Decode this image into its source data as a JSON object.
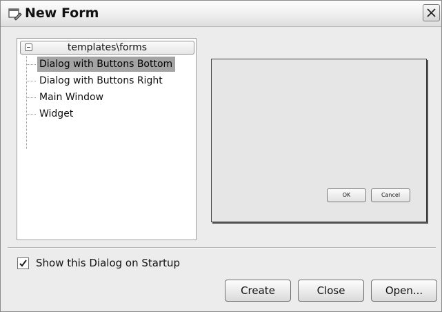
{
  "window": {
    "title": "New Form",
    "icon": "form-icon",
    "close_icon": "close-icon"
  },
  "tree": {
    "root_label": "templates\\forms",
    "root_expanded": true,
    "items": [
      {
        "label": "Dialog with Buttons Bottom",
        "selected": true
      },
      {
        "label": "Dialog with Buttons Right",
        "selected": false
      },
      {
        "label": "Main Window",
        "selected": false
      },
      {
        "label": "Widget",
        "selected": false
      }
    ]
  },
  "preview": {
    "ok_label": "OK",
    "cancel_label": "Cancel"
  },
  "startup": {
    "label": "Show this Dialog on Startup",
    "checked": true
  },
  "buttons": {
    "create": "Create",
    "close": "Close",
    "open": "Open..."
  }
}
